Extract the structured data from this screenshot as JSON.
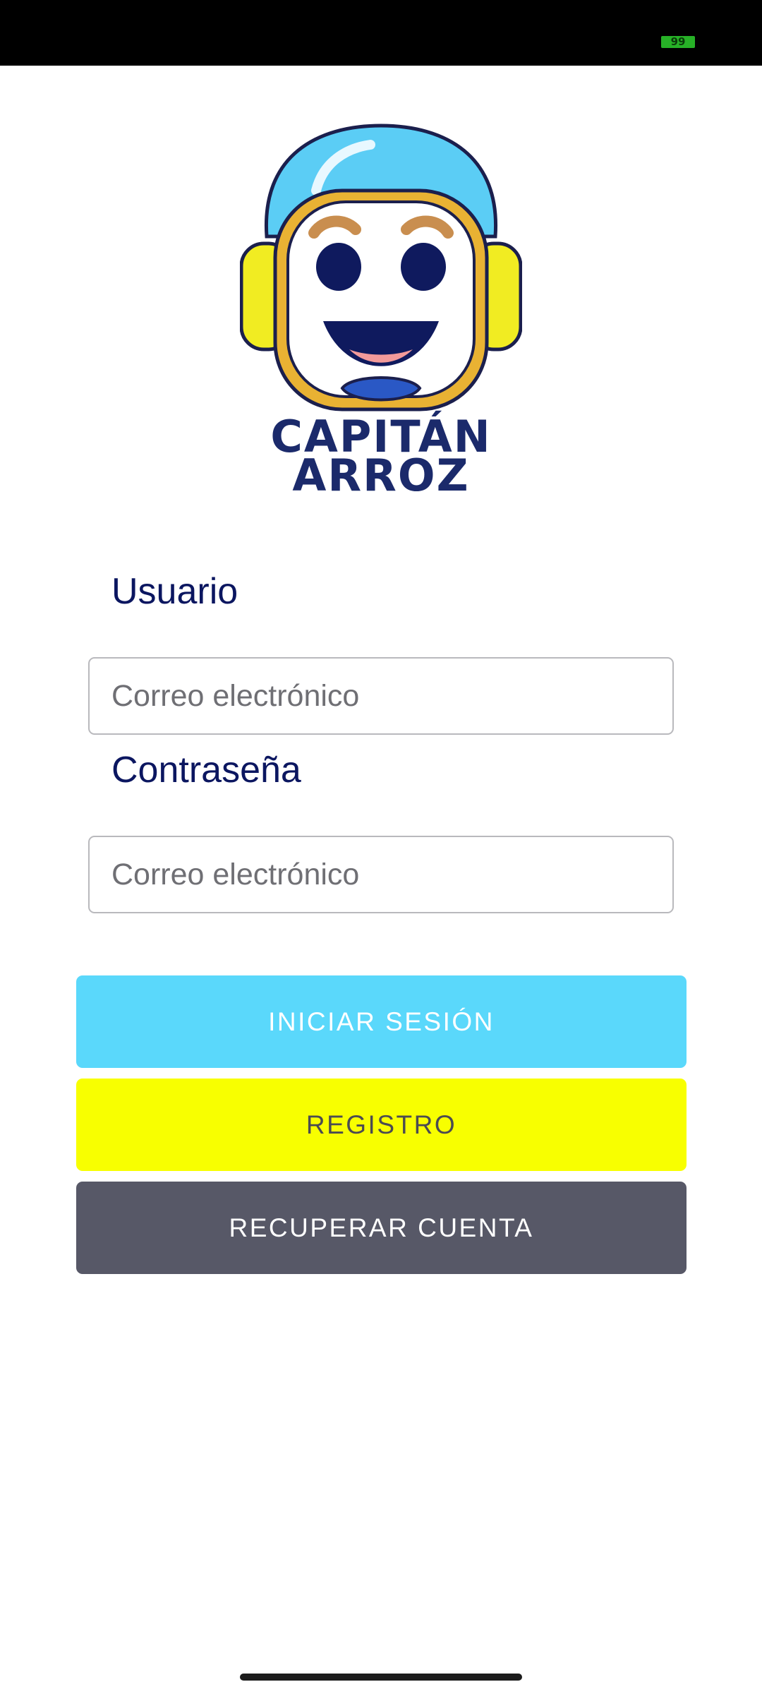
{
  "status_bar": {
    "battery_level": "99",
    "battery_color": "#27b127"
  },
  "logo": {
    "line1": "CAPITÁN",
    "line2": "ARROZ"
  },
  "login_form": {
    "user_label": "Usuario",
    "user_placeholder": "Correo electrónico",
    "password_label": "Contraseña",
    "password_placeholder": "Correo electrónico"
  },
  "buttons": {
    "login": "INICIAR SESIÓN",
    "register": "REGISTRO",
    "recover": "RECUPERAR CUENTA"
  },
  "colors": {
    "login_button": "#5ad8fb",
    "register_button": "#f8ff00",
    "recover_button": "#575867",
    "label_text": "#0b1660"
  }
}
